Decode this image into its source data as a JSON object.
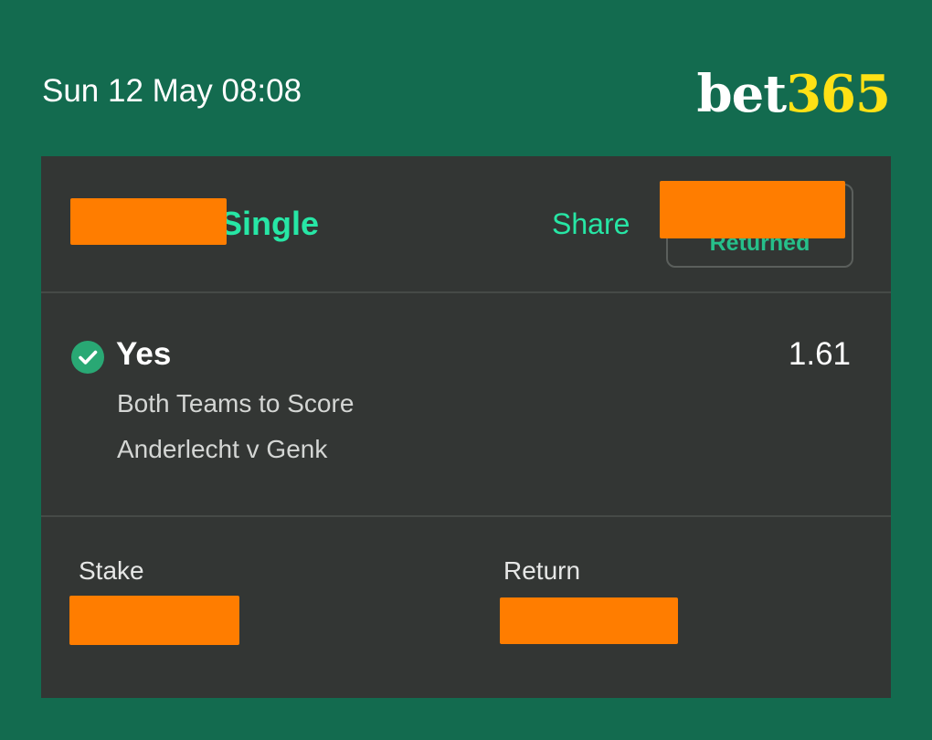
{
  "header": {
    "datetime": "Sun 12 May 08:08",
    "logo_bet": "bet",
    "logo_num": "365"
  },
  "bet_card": {
    "bet_type": "Single",
    "share_label": "Share",
    "status_label": "Returned",
    "selection": {
      "name": "Yes",
      "odds": "1.61",
      "market": "Both Teams to Score",
      "event": "Anderlecht v Genk"
    },
    "stake_label": "Stake",
    "return_label": "Return"
  },
  "colors": {
    "background": "#136b4f",
    "card": "#333634",
    "accent": "#27e6a5",
    "logo_yellow": "#ffe115",
    "redaction": "#ff7d00",
    "check": "#29a874"
  },
  "icons": {
    "won": "check-circle-icon"
  }
}
